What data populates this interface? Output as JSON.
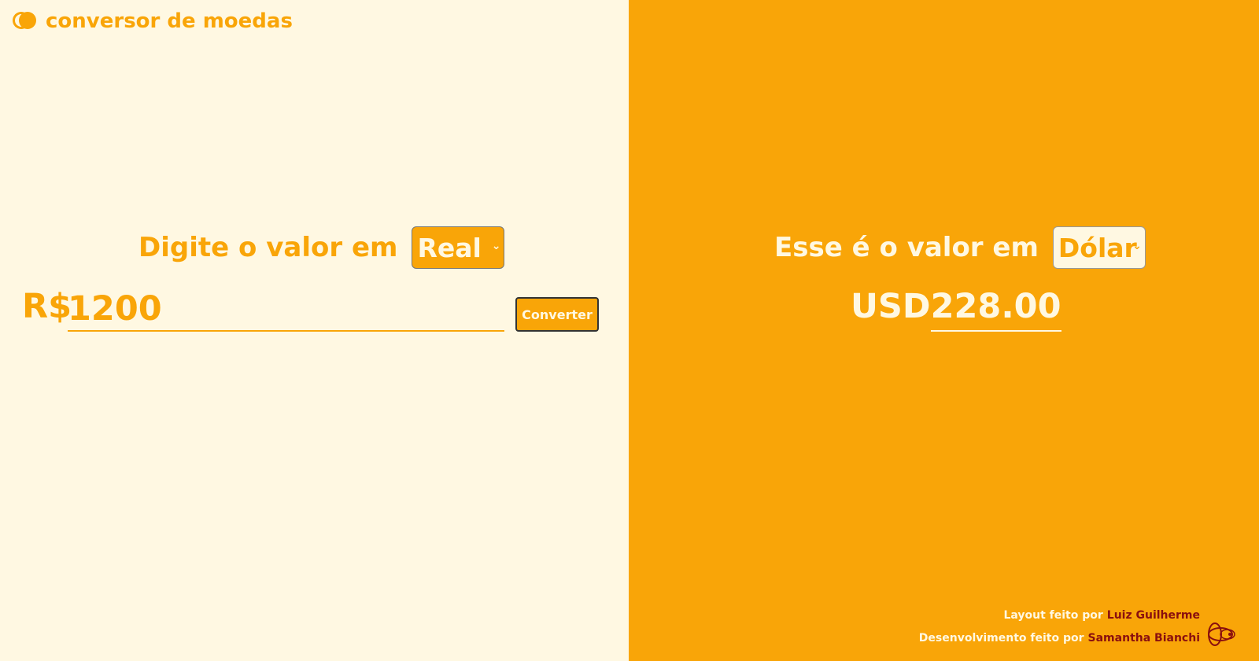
{
  "app": {
    "logo_text": "conversor de moedas",
    "colors": {
      "primary": "#f9a508",
      "background_light": "#fff8e2",
      "credit_name": "#8a0f0f"
    }
  },
  "input_panel": {
    "label": "Digite o valor em",
    "currency_select": {
      "selected": "Real"
    },
    "currency_symbol": "R$",
    "amount_value": "1200",
    "convert_button": "Converter"
  },
  "output_panel": {
    "label": "Esse é o valor em",
    "currency_select": {
      "selected": "Dólar"
    },
    "currency_symbol": "USD",
    "result_value": "228.00"
  },
  "credits": {
    "layout_prefix": "Layout feito por",
    "layout_author": "Luiz Guilherme",
    "dev_prefix": "Desenvolvimento feito por",
    "dev_author": "Samantha Bianchi",
    "icon": "bee-icon"
  }
}
